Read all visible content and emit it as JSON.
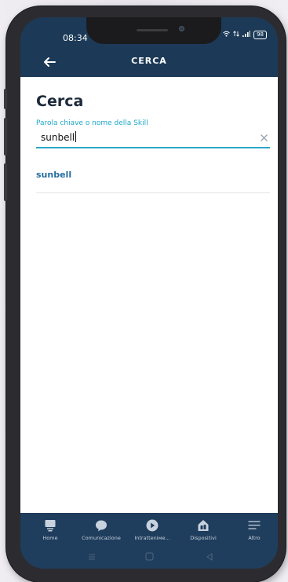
{
  "status_bar": {
    "time": "08:34",
    "battery": "98"
  },
  "header": {
    "title": "CERCA"
  },
  "page": {
    "title": "Cerca"
  },
  "search": {
    "label": "Parola chiave o nome della Skill",
    "value": "sunbell"
  },
  "results": [
    {
      "label": "sunbell"
    }
  ],
  "bottom_nav": {
    "items": [
      {
        "label": "Home",
        "icon": "home-icon"
      },
      {
        "label": "Comunicazione",
        "icon": "chat-bubble-icon"
      },
      {
        "label": "Intratteniме...",
        "icon": "play-icon"
      },
      {
        "label": "Dispositivi",
        "icon": "devices-icon"
      },
      {
        "label": "Altro",
        "icon": "menu-icon"
      }
    ]
  },
  "colors": {
    "header_bg": "#1c3a57",
    "accent": "#1fa7c9",
    "result_text": "#246fa0"
  }
}
